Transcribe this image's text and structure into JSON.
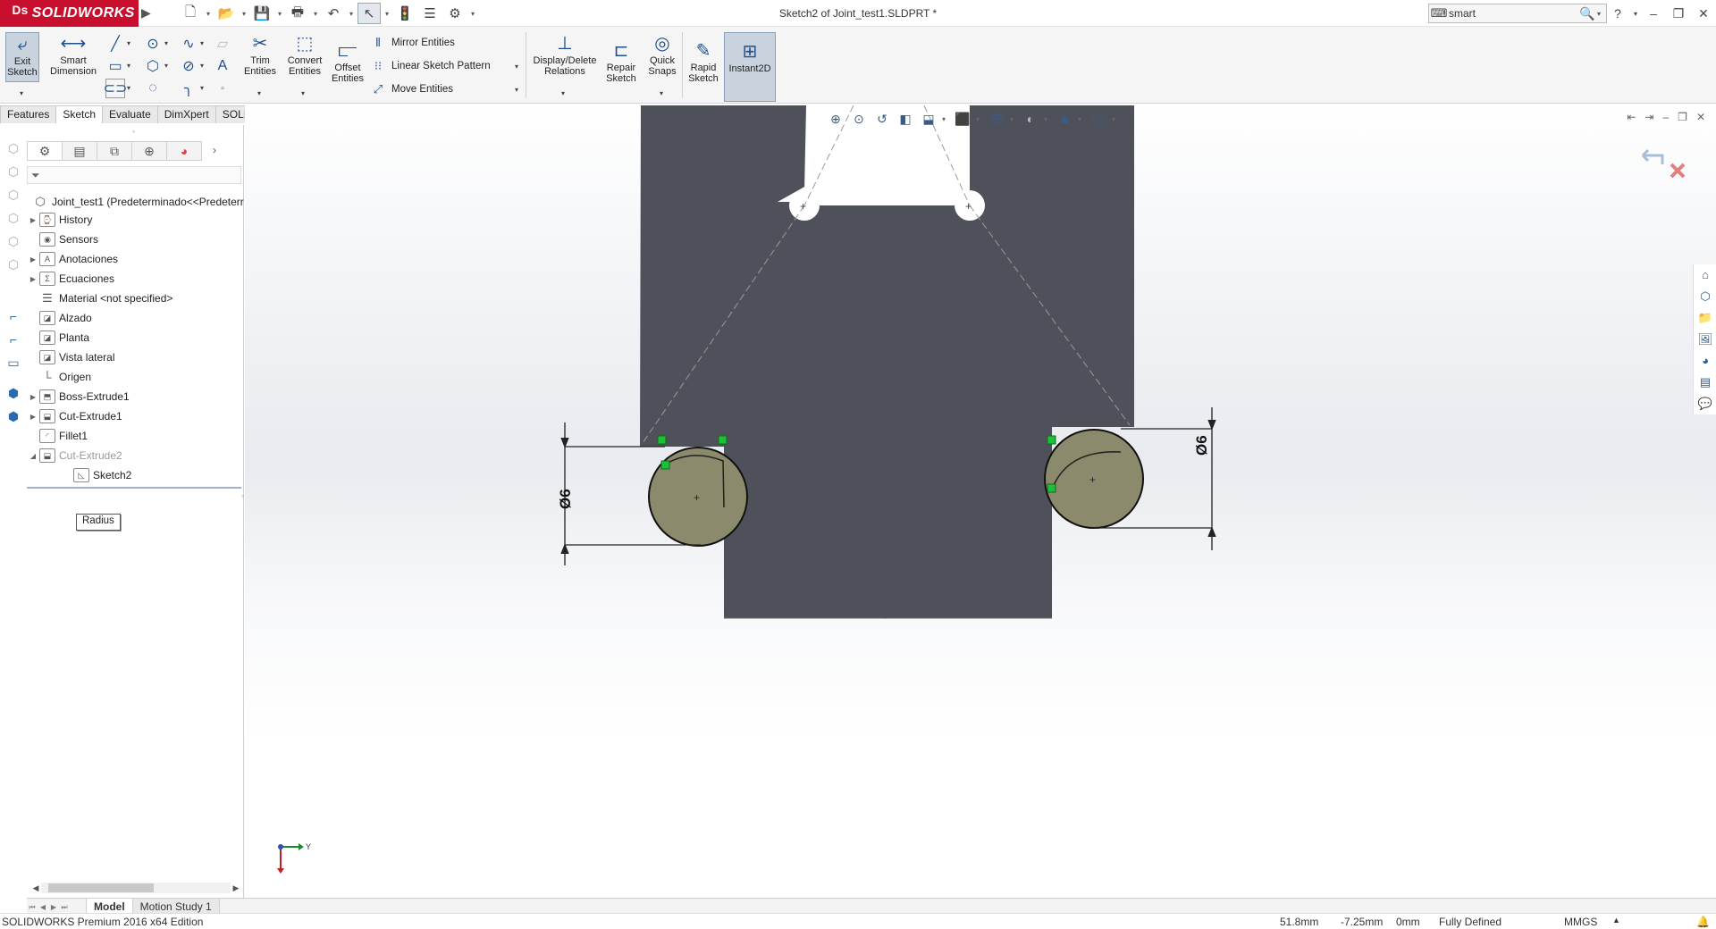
{
  "app": {
    "brand": "SOLIDWORKS",
    "document_title": "Sketch2 of Joint_test1.SLDPRT *",
    "search": {
      "value": "smart"
    }
  },
  "ribbon": {
    "exit_sketch": "Exit Sketch",
    "smart_dimension": "Smart Dimension",
    "trim_entities": "Trim Entities",
    "convert_entities": "Convert Entities",
    "offset_entities": "Offset Entities",
    "mirror_entities": "Mirror Entities",
    "linear_sketch_pattern": "Linear Sketch Pattern",
    "move_entities": "Move Entities",
    "display_delete_relations": "Display/Delete Relations",
    "repair_sketch": "Repair Sketch",
    "quick_snaps": "Quick Snaps",
    "rapid_sketch": "Rapid Sketch",
    "instant2d": "Instant2D"
  },
  "command_tabs": [
    "Features",
    "Sketch",
    "Evaluate",
    "DimXpert",
    "SOLIDWORKS Add-Ins"
  ],
  "active_command_tab": "Sketch",
  "feature_tree": {
    "root": "Joint_test1  (Predeterminado<<Predeterr",
    "items": [
      {
        "label": "History",
        "expandable": true,
        "icon": "history-folder-icon"
      },
      {
        "label": "Sensors",
        "expandable": false,
        "icon": "sensors-folder-icon"
      },
      {
        "label": "Anotaciones",
        "expandable": true,
        "icon": "annotations-folder-icon"
      },
      {
        "label": "Ecuaciones",
        "expandable": true,
        "icon": "equations-folder-icon"
      },
      {
        "label": "Material <not specified>",
        "expandable": false,
        "icon": "material-icon"
      },
      {
        "label": "Alzado",
        "expandable": false,
        "icon": "plane-icon"
      },
      {
        "label": "Planta",
        "expandable": false,
        "icon": "plane-icon"
      },
      {
        "label": "Vista lateral",
        "expandable": false,
        "icon": "plane-icon"
      },
      {
        "label": "Origen",
        "expandable": false,
        "icon": "origin-icon"
      },
      {
        "label": "Boss-Extrude1",
        "expandable": true,
        "icon": "boss-extrude-icon"
      },
      {
        "label": "Cut-Extrude1",
        "expandable": true,
        "icon": "cut-extrude-icon"
      },
      {
        "label": "Fillet1",
        "expandable": false,
        "icon": "fillet-icon"
      },
      {
        "label": "Cut-Extrude2",
        "expandable": true,
        "expanded": true,
        "dim": true,
        "icon": "cut-extrude-icon"
      },
      {
        "label": "Sketch2",
        "expandable": false,
        "child": true,
        "icon": "sketch-icon"
      }
    ]
  },
  "tooltip": "Radius",
  "viewport": {
    "dimension_left": "Ø6",
    "dimension_right": "Ø6",
    "triad_y_label": "Y"
  },
  "bottom_tabs": [
    "Model",
    "Motion Study 1"
  ],
  "status": {
    "edition": "SOLIDWORKS Premium 2016 x64 Edition",
    "x": "51.8mm",
    "y": "-7.25mm",
    "z": "0mm",
    "state": "Fully Defined",
    "units": "MMGS"
  },
  "colors": {
    "brand_red": "#c8102e",
    "part_face": "#4f515a",
    "sketch_circle_fill": "#8c8a6c",
    "relation_green": "#1fbf3a"
  }
}
